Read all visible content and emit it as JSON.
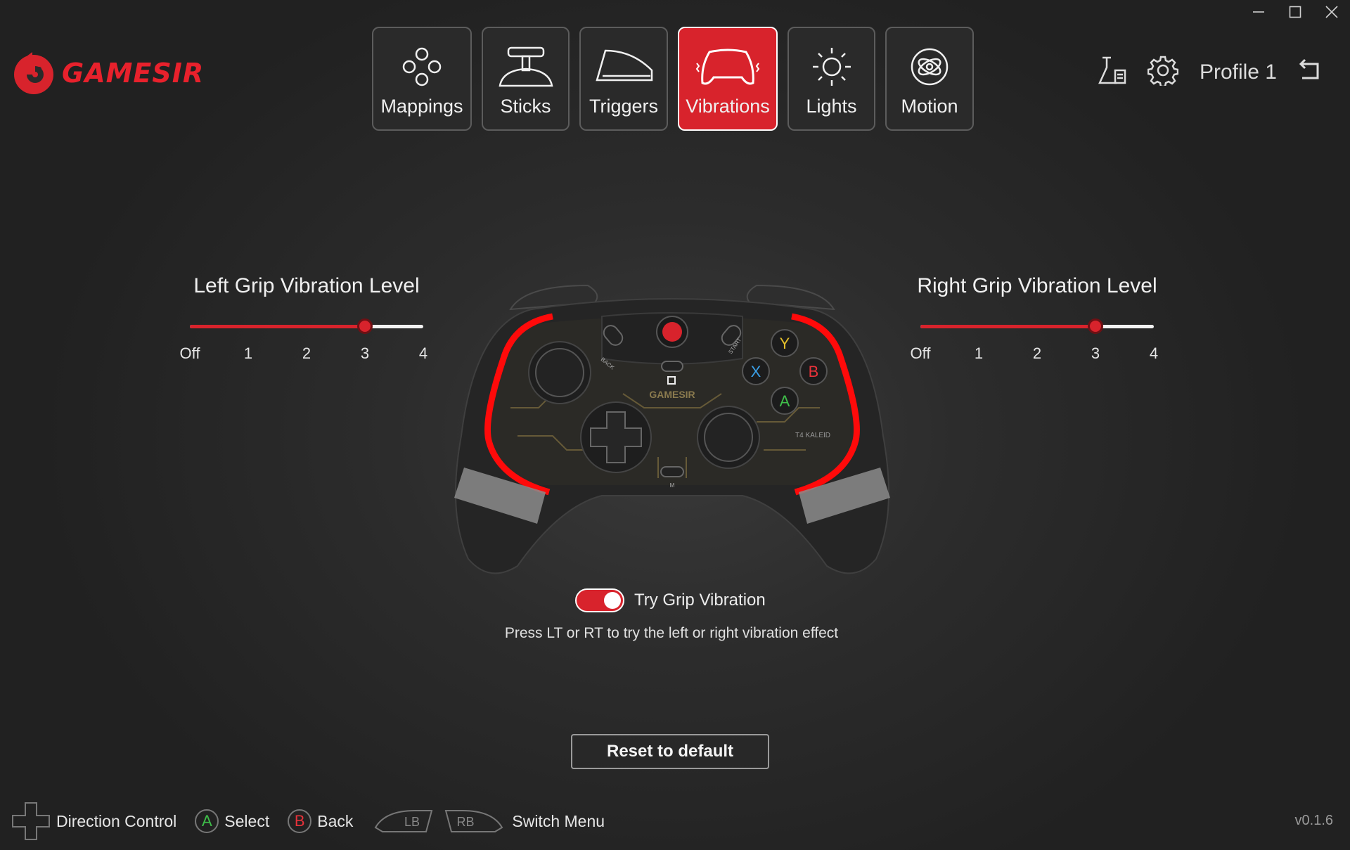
{
  "app": {
    "brand": "GAMESIR",
    "accent_color": "#d8232c",
    "version": "v0.1.6"
  },
  "window_controls": [
    {
      "name": "minimize-icon"
    },
    {
      "name": "maximize-icon"
    },
    {
      "name": "close-icon"
    }
  ],
  "tabs": [
    {
      "label": "Mappings",
      "icon": "mappings-icon",
      "active": false
    },
    {
      "label": "Sticks",
      "icon": "stick-icon",
      "active": false
    },
    {
      "label": "Triggers",
      "icon": "trigger-icon",
      "active": false
    },
    {
      "label": "Vibrations",
      "icon": "gamepad-vibration-icon",
      "active": true
    },
    {
      "label": "Lights",
      "icon": "sun-icon",
      "active": false
    },
    {
      "label": "Motion",
      "icon": "gyro-icon",
      "active": false
    }
  ],
  "header": {
    "profile_name": "Profile 1"
  },
  "left_slider": {
    "title": "Left Grip Vibration Level",
    "ticks": [
      "Off",
      "1",
      "2",
      "3",
      "4"
    ],
    "value_index": 3
  },
  "right_slider": {
    "title": "Right Grip Vibration Level",
    "ticks": [
      "Off",
      "1",
      "2",
      "3",
      "4"
    ],
    "value_index": 3
  },
  "controller": {
    "face_buttons": {
      "y": "Y",
      "x": "X",
      "b": "B",
      "a": "A"
    },
    "brand": "GAMESIR",
    "model": "T4 KALEID",
    "back_label": "BACK",
    "start_label": "START",
    "m_label": "M"
  },
  "try_vibration": {
    "label": "Try Grip Vibration",
    "enabled": true,
    "hint": "Press LT or RT to try the left or right vibration effect"
  },
  "reset_label": "Reset to default",
  "footer": {
    "direction": "Direction Control",
    "a_key": "A",
    "select": "Select",
    "b_key": "B",
    "back": "Back",
    "lb": "LB",
    "rb": "RB",
    "switch_menu": "Switch Menu"
  }
}
